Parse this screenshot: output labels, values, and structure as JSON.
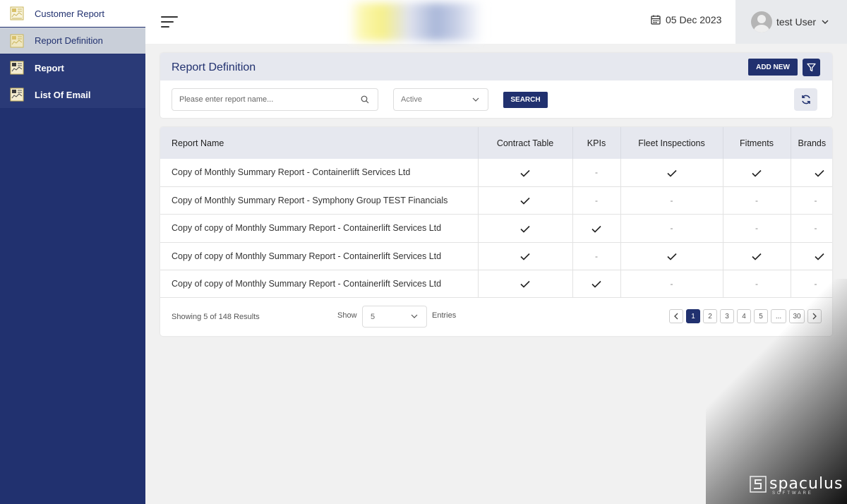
{
  "sidebar": {
    "brand": "Customer Report",
    "items": [
      {
        "label": "Report Definition"
      },
      {
        "label": "Report"
      },
      {
        "label": "List Of Email"
      }
    ]
  },
  "header": {
    "date": "05 Dec 2023",
    "user": "test User"
  },
  "panel": {
    "title": "Report Definition",
    "add_new": "ADD NEW",
    "search_placeholder": "Please enter report name...",
    "status_value": "Active",
    "search_button": "SEARCH"
  },
  "table": {
    "columns": [
      "Report Name",
      "Contract Table",
      "KPIs",
      "Fleet Inspections",
      "Fitments",
      "Brands"
    ],
    "rows": [
      {
        "name": "Copy of Monthly Summary Report - Containerlift Services Ltd",
        "cells": [
          "check",
          "dash",
          "check",
          "check",
          "check"
        ]
      },
      {
        "name": "Copy of Monthly Summary Report - Symphony Group TEST Financials",
        "cells": [
          "check",
          "dash",
          "dash",
          "dash",
          "dash"
        ]
      },
      {
        "name": "Copy of copy of Monthly Summary Report - Containerlift Services Ltd",
        "cells": [
          "check",
          "check",
          "dash",
          "dash",
          "dash"
        ]
      },
      {
        "name": "Copy of copy of Monthly Summary Report - Containerlift Services Ltd",
        "cells": [
          "check",
          "dash",
          "check",
          "check",
          "check"
        ]
      },
      {
        "name": "Copy of copy of Monthly Summary Report - Containerlift Services Ltd",
        "cells": [
          "check",
          "check",
          "dash",
          "dash",
          "dash"
        ]
      }
    ],
    "dash_symbol": "-"
  },
  "footer": {
    "showing": "Showing 5 of 148 Results",
    "show_label": "Show",
    "entries_value": "5",
    "entries_label": "Entries",
    "pages": [
      "1",
      "2",
      "3",
      "4",
      "5",
      "...",
      "30"
    ],
    "active_page": "1"
  },
  "watermark": {
    "name": "spaculus",
    "sub": "SOFTWARE"
  },
  "colors": {
    "primary": "#21316f",
    "sidebar": "#21316f",
    "active_item": "#c9cfd9",
    "panel_head": "#e6e8ef",
    "background": "#f1f1f1"
  }
}
